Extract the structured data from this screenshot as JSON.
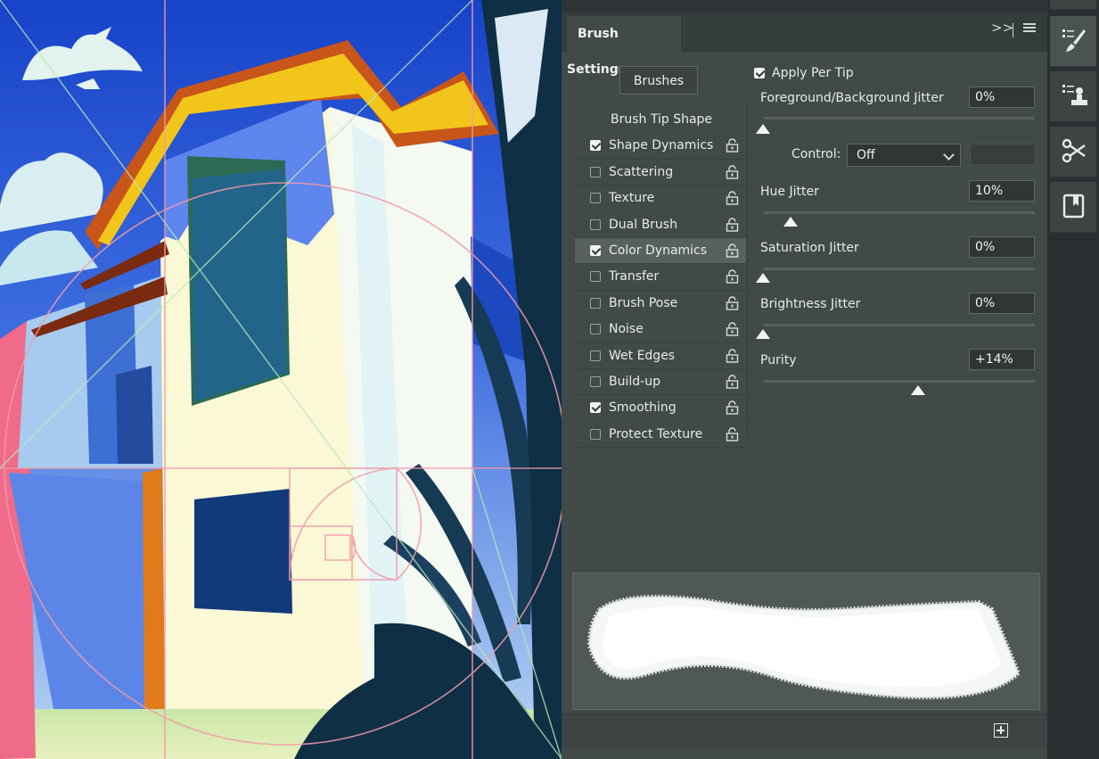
{
  "panel": {
    "tab_title": "Brush Settings",
    "collapse_glyph": ">>",
    "brushes_button": "Brushes",
    "apply_per_tip": {
      "label": "Apply Per Tip",
      "checked": true
    },
    "list": [
      {
        "label": "Brush Tip Shape",
        "type": "header"
      },
      {
        "label": "Shape Dynamics",
        "checked": true
      },
      {
        "label": "Scattering",
        "checked": false
      },
      {
        "label": "Texture",
        "checked": false
      },
      {
        "label": "Dual Brush",
        "checked": false
      },
      {
        "label": "Color Dynamics",
        "checked": true,
        "selected": true
      },
      {
        "label": "Transfer",
        "checked": false
      },
      {
        "label": "Brush Pose",
        "checked": false
      },
      {
        "label": "Noise",
        "checked": false
      },
      {
        "label": "Wet Edges",
        "checked": false
      },
      {
        "label": "Build-up",
        "checked": false
      },
      {
        "label": "Smoothing",
        "checked": true
      },
      {
        "label": "Protect Texture",
        "checked": false
      }
    ],
    "settings": {
      "fg_bg_jitter": {
        "label": "Foreground/Background Jitter",
        "value": "0%",
        "slider_fraction": 0.0
      },
      "control": {
        "label": "Control:",
        "value": "Off"
      },
      "hue_jitter": {
        "label": "Hue Jitter",
        "value": "10%",
        "slider_fraction": 0.1
      },
      "saturation_jitter": {
        "label": "Saturation Jitter",
        "value": "0%",
        "slider_fraction": 0.0
      },
      "brightness_jitter": {
        "label": "Brightness Jitter",
        "value": "0%",
        "slider_fraction": 0.0
      },
      "purity": {
        "label": "Purity",
        "value": "+14%",
        "slider_fraction": 0.57
      }
    }
  },
  "colors": {
    "panel_bg": "#424a48",
    "selected_row": "#59615f",
    "sky": "#1f4fd0",
    "wall": "#fbf7d2"
  },
  "icons": [
    "lock-icon",
    "brush-settings-icon",
    "clone-source-icon",
    "tool-presets-icon",
    "notes-icon",
    "new-brush-icon"
  ]
}
